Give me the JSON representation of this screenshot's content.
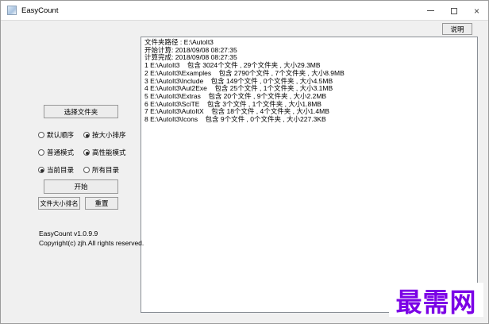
{
  "window": {
    "title": "EasyCount",
    "app_icon": "easycount-app-icon",
    "control_icons": [
      "minimize-icon",
      "maximize-icon",
      "close-icon"
    ],
    "close_glyph": "×"
  },
  "help": {
    "label": "说明"
  },
  "sidebar": {
    "select_folder_label": "选择文件夹",
    "radio_options": [
      {
        "label": "默认顺序",
        "checked": false
      },
      {
        "label": "按大小排序",
        "checked": true
      },
      {
        "label": "普通模式",
        "checked": false
      },
      {
        "label": "高性能模式",
        "checked": true
      },
      {
        "label": "当前目录",
        "checked": true
      },
      {
        "label": "所有目录",
        "checked": false
      }
    ],
    "start_label": "开始",
    "size_rank_label": "文件大小排名",
    "reset_label": "重置",
    "version": "EasyCount v1.0.9.9",
    "copyright": "Copyright(c) zjh.All rights reserved."
  },
  "output": {
    "lines": [
      "文件夹路径 : E:\\AutoIt3",
      "开始计算: 2018/09/08 08:27:35",
      "计算完成: 2018/09/08 08:27:35",
      "1 E:\\AutoIt3    包含 3024个文件 , 29个文件夹 , 大小29.3MB",
      "2 E:\\AutoIt3\\Examples    包含 2790个文件 , 7个文件夹 , 大小8.9MB",
      "3 E:\\AutoIt3\\Include    包含 149个文件 , 0个文件夹 , 大小4.5MB",
      "4 E:\\AutoIt3\\Aut2Exe    包含 25个文件 , 1个文件夹 , 大小3.1MB",
      "5 E:\\AutoIt3\\Extras    包含 20个文件 , 9个文件夹 , 大小2.2MB",
      "6 E:\\AutoIt3\\SciTE    包含 3个文件 , 1个文件夹 , 大小1.8MB",
      "7 E:\\AutoIt3\\AutoItX    包含 18个文件 , 4个文件夹 , 大小1.4MB",
      "8 E:\\AutoIt3\\Icons    包含 9个文件 , 0个文件夹 , 大小227.3KB"
    ]
  },
  "watermark": {
    "text": "最需网",
    "color": "#7b00e6"
  }
}
